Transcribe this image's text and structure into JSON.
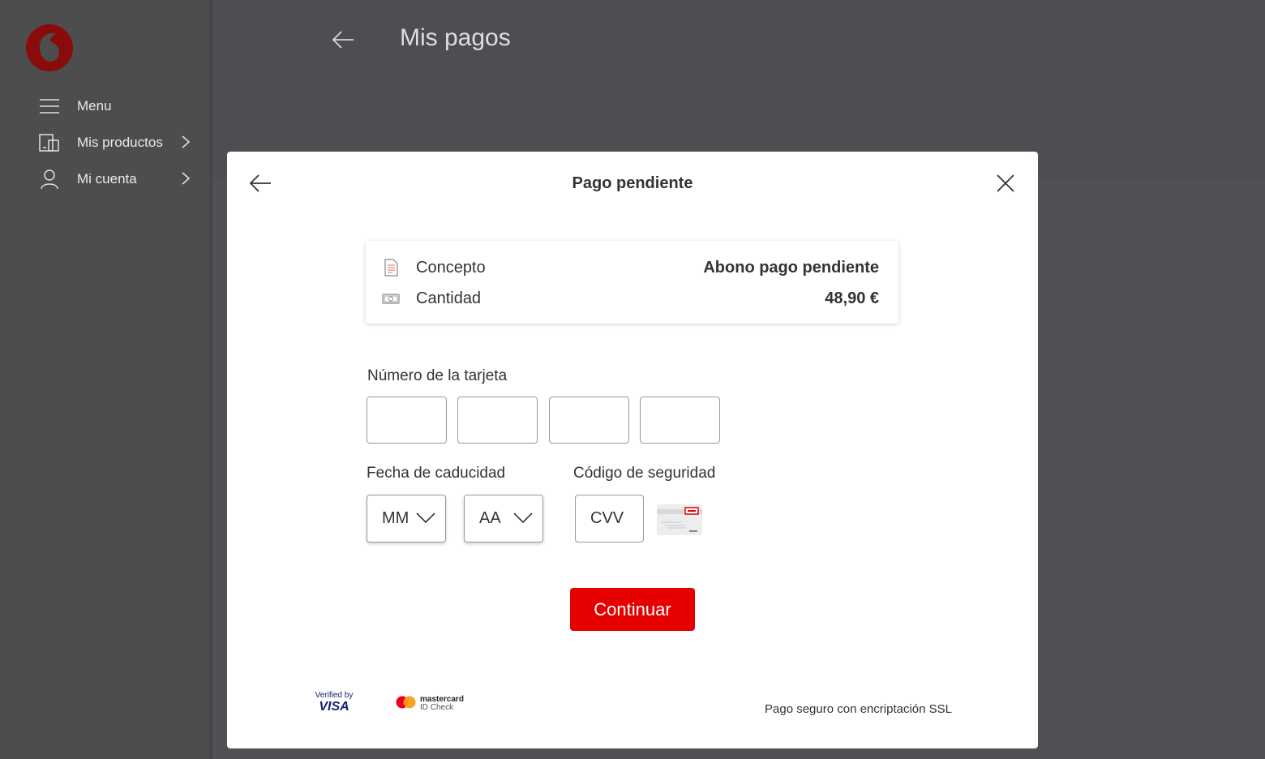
{
  "sidebar": {
    "items": [
      {
        "label": "Menu",
        "icon": "hamburger-icon"
      },
      {
        "label": "Mis productos",
        "icon": "devices-icon"
      },
      {
        "label": "Mi cuenta",
        "icon": "user-icon"
      }
    ]
  },
  "header": {
    "title": "Mis pagos"
  },
  "modal": {
    "title": "Pago pendiente",
    "summary": {
      "concept_label": "Concepto",
      "concept_value": "Abono pago pendiente",
      "amount_label": "Cantidad",
      "amount_value": "48,90 €"
    },
    "card_number_label": "Número de la tarjeta",
    "expiry_label": "Fecha de caducidad",
    "month_placeholder": "MM",
    "year_placeholder": "AA",
    "security_label": "Código de seguridad",
    "cvv_placeholder": "CVV",
    "continue_label": "Continuar",
    "ssl_text": "Pago seguro con encriptación SSL",
    "visa_top": "Verified by",
    "visa_brand": "VISA",
    "mc_brand": "mastercard",
    "mc_sub": "ID Check"
  },
  "colors": {
    "brand_red": "#e60000",
    "overlay": "#515155"
  }
}
